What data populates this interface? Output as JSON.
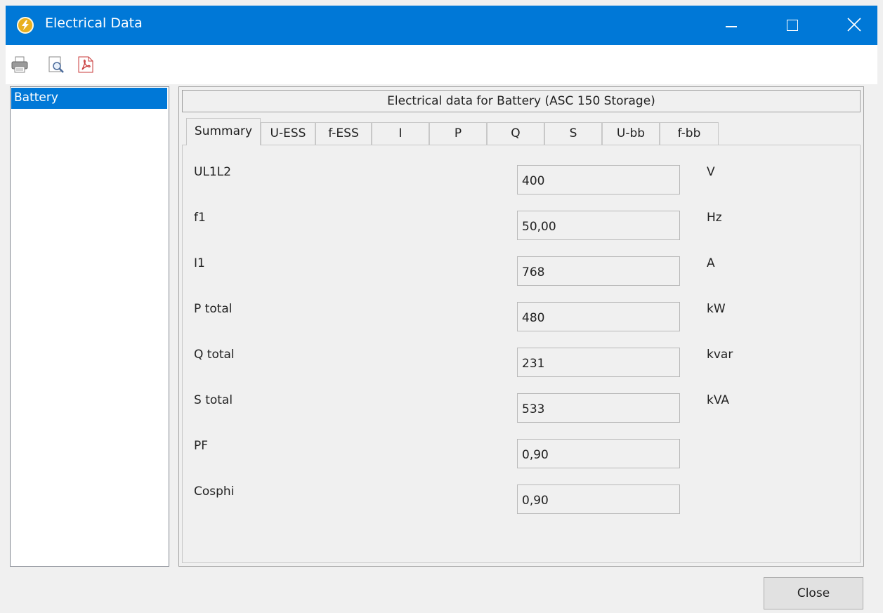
{
  "window": {
    "title": "Electrical Data"
  },
  "toolbar": {
    "icons": [
      "printer-icon",
      "print-preview-icon",
      "pdf-export-icon"
    ]
  },
  "sidebar": {
    "items": [
      {
        "label": "Battery",
        "selected": true
      }
    ]
  },
  "panel": {
    "header": "Electrical data for Battery (ASC 150 Storage)",
    "tabs": [
      "Summary",
      "U-ESS",
      "f-ESS",
      "I",
      "P",
      "Q",
      "S",
      "U-bb",
      "f-bb"
    ],
    "active_tab": "Summary",
    "rows": [
      {
        "label": "UL1L2",
        "value": "400",
        "unit": "V"
      },
      {
        "label": "f1",
        "value": "50,00",
        "unit": "Hz"
      },
      {
        "label": "I1",
        "value": "768",
        "unit": "A"
      },
      {
        "label": "P total",
        "value": "480",
        "unit": "kW"
      },
      {
        "label": "Q total",
        "value": "231",
        "unit": "kvar"
      },
      {
        "label": "S total",
        "value": "533",
        "unit": "kVA"
      },
      {
        "label": "PF",
        "value": "0,90",
        "unit": ""
      },
      {
        "label": "Cosphi",
        "value": "0,90",
        "unit": ""
      }
    ]
  },
  "footer": {
    "close_label": "Close"
  },
  "colors": {
    "titlebar": "#0078d7",
    "selection": "#0078d7"
  }
}
